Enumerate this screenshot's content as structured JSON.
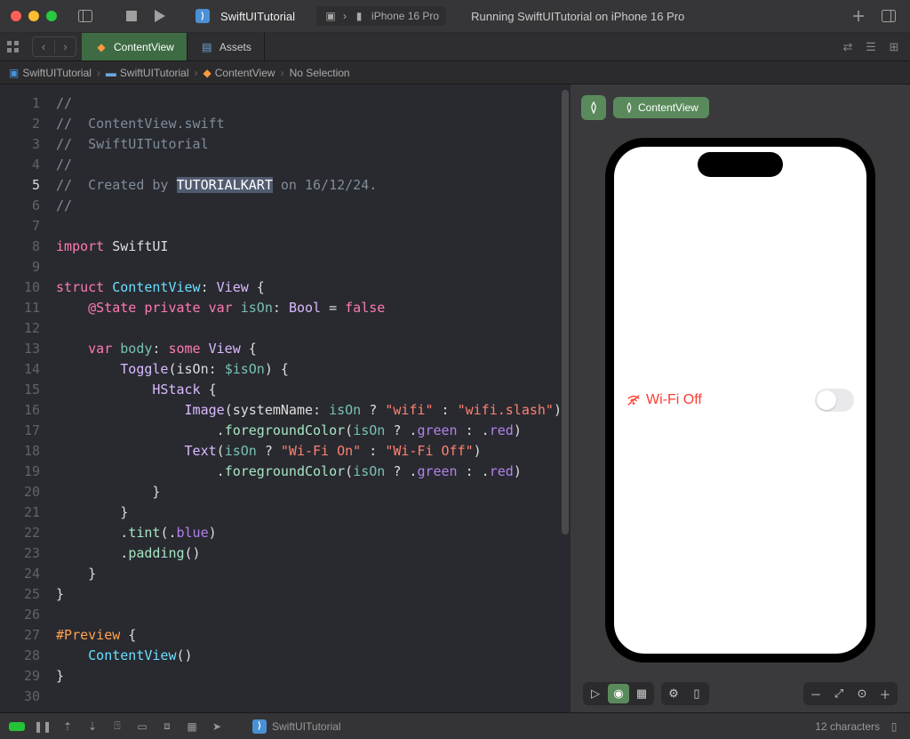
{
  "project": {
    "name": "SwiftUITutorial"
  },
  "scheme": {
    "device": "iPhone 16 Pro"
  },
  "status": "Running SwiftUITutorial on iPhone 16 Pro",
  "tabs": {
    "active": "ContentView",
    "second": "Assets"
  },
  "breadcrumb": {
    "a": "SwiftUITutorial",
    "b": "SwiftUITutorial",
    "c": "ContentView",
    "d": "No Selection"
  },
  "gutter": {
    "lines": 30,
    "cursorLine": 5
  },
  "code": {
    "l1": "//",
    "l2a": "//",
    "l2b": "  ContentView.swift",
    "l3a": "//",
    "l3b": "  SwiftUITutorial",
    "l4": "//",
    "l5a": "//",
    "l5b": "  Created by ",
    "l5sel": "TUTORIALKART",
    "l5c": " on 16/12/24.",
    "l6": "//",
    "l8a": "import",
    "l8b": " SwiftUI",
    "l10a": "struct",
    "l10b": " ContentView",
    "l10c": ": ",
    "l10d": "View",
    "l10e": " {",
    "l11a": "    @State",
    "l11b": " private",
    "l11c": " var",
    "l11d": " isOn",
    "l11e": ": ",
    "l11f": "Bool",
    "l11g": " = ",
    "l11h": "false",
    "l13a": "    var",
    "l13b": " body",
    "l13c": ": ",
    "l13d": "some",
    "l13e": " View",
    "l13f": " {",
    "l14a": "        Toggle",
    "l14b": "(isOn: ",
    "l14c": "$isOn",
    "l14d": ") {",
    "l15a": "            HStack",
    "l15b": " {",
    "l16a": "                Image",
    "l16b": "(systemName: ",
    "l16c": "isOn",
    "l16d": " ? ",
    "l16e": "\"wifi\"",
    "l16f": " : ",
    "l16g": "\"wifi.slash\"",
    "l16h": ")",
    "l17a": "                    .",
    "l17b": "foregroundColor",
    "l17c": "(",
    "l17d": "isOn",
    "l17e": " ? .",
    "l17f": "green",
    "l17g": " : .",
    "l17h": "red",
    "l17i": ")",
    "l18a": "                Text",
    "l18b": "(",
    "l18c": "isOn",
    "l18d": " ? ",
    "l18e": "\"Wi-Fi On\"",
    "l18f": " : ",
    "l18g": "\"Wi-Fi Off\"",
    "l18h": ")",
    "l19a": "                    .",
    "l19b": "foregroundColor",
    "l19c": "(",
    "l19d": "isOn",
    "l19e": " ? .",
    "l19f": "green",
    "l19g": " : .",
    "l19h": "red",
    "l19i": ")",
    "l20": "            }",
    "l21": "        }",
    "l22a": "        .",
    "l22b": "tint",
    "l22c": "(.",
    "l22d": "blue",
    "l22e": ")",
    "l23a": "        .",
    "l23b": "padding",
    "l23c": "()",
    "l24": "    }",
    "l25": "}",
    "l27a": "#Preview",
    "l27b": " {",
    "l28a": "    ContentView",
    "l28b": "()",
    "l29": "}"
  },
  "preview": {
    "chip": "ContentView",
    "wifiLabel": "Wi-Fi Off"
  },
  "statusbar": {
    "proj": "SwiftUITutorial",
    "chars": "12 characters"
  }
}
